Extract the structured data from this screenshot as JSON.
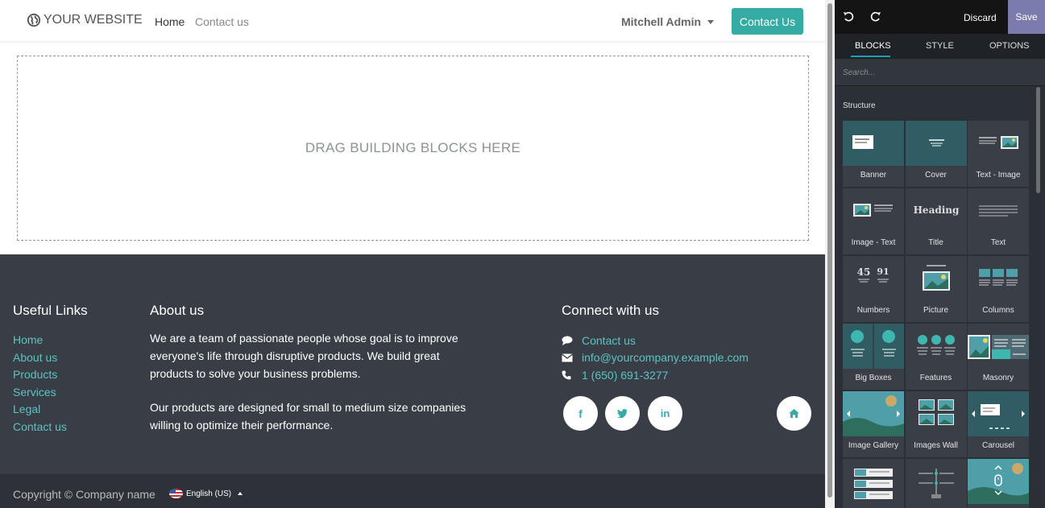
{
  "site": {
    "brand": "YOUR WEBSITE",
    "nav": {
      "home": "Home",
      "contact": "Contact us"
    },
    "user": "Mitchell Admin",
    "cta": "Contact Us",
    "dropzone": "DRAG BUILDING BLOCKS HERE",
    "footer": {
      "useful_links_title": "Useful Links",
      "links": [
        "Home",
        "About us",
        "Products",
        "Services",
        "Legal",
        "Contact us"
      ],
      "about_title": "About us",
      "about_p1": "We are a team of passionate people whose goal is to improve everyone's life through disruptive products. We build great products to solve your business problems.",
      "about_p2": "Our products are designed for small to medium size companies willing to optimize their performance.",
      "connect_title": "Connect with us",
      "connect": {
        "contact": "Contact us",
        "email": "info@yourcompany.example.com",
        "phone": "1 (650) 691-3277"
      },
      "social_icons": [
        "facebook-icon",
        "twitter-icon",
        "linkedin-icon",
        "home-icon"
      ],
      "copyright": "Copyright © Company name",
      "language": "English (US)"
    }
  },
  "editor": {
    "discard": "Discard",
    "save": "Save",
    "tabs": [
      "BLOCKS",
      "STYLE",
      "OPTIONS"
    ],
    "search_placeholder": "Search...",
    "section": "Structure",
    "blocks": [
      "Banner",
      "Cover",
      "Text - Image",
      "Image - Text",
      "Title",
      "Text",
      "Numbers",
      "Picture",
      "Columns",
      "Big Boxes",
      "Features",
      "Masonry",
      "Image Gallery",
      "Images Wall",
      "Carousel",
      "",
      "",
      ""
    ],
    "thumb_text": {
      "title": "Heading",
      "num1": "45",
      "num2": "91"
    }
  },
  "colors": {
    "accent": "#35aba4",
    "link": "#5dc2c2",
    "footer": "#393e46",
    "save": "#7c7bad",
    "tab_active": "#17a2b8"
  }
}
